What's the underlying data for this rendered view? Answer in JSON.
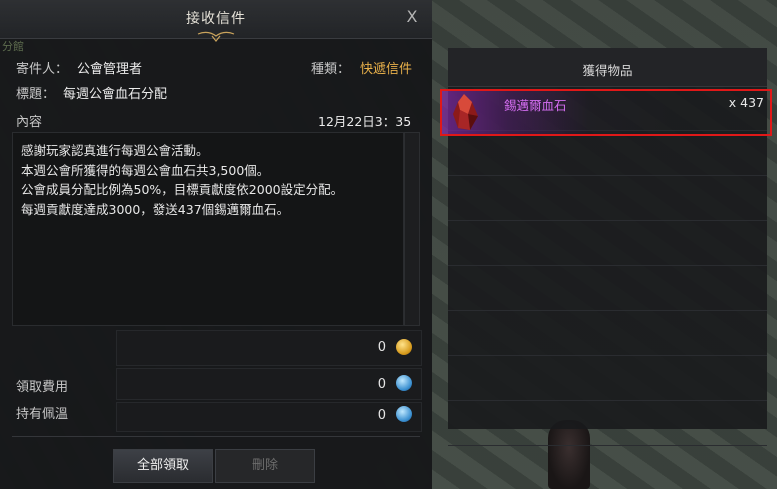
{
  "window": {
    "title": "接收信件",
    "close_label": "X",
    "guild_tag": "分館"
  },
  "header": {
    "sender_label": "寄件人：",
    "sender_value": "公會管理者",
    "type_label": "種類：",
    "type_value": "快遞信件",
    "subject_label": "標題：",
    "subject_value": "每週公會血石分配",
    "content_label": "內容",
    "date": "12月22日3：35"
  },
  "body": {
    "lines": [
      "感謝玩家認真進行每週公會活動。",
      "本週公會所獲得的每週公會血石共3,500個。",
      "公會成員分配比例為50%，目標貢獻度依2000設定分配。",
      "每週貢獻度達成3000，發送437個錫邁爾血石。"
    ]
  },
  "costs": {
    "gold_amount": "0",
    "fee_label": "領取費用",
    "fee_amount": "0",
    "held_label": "持有佩溫",
    "held_amount": "0"
  },
  "buttons": {
    "claim_all": "全部領取",
    "delete": "刪除"
  },
  "attachments": {
    "title": "獲得物品",
    "items": [
      {
        "name": "錫邁爾血石",
        "quantity": "x 437",
        "icon": "bloodstone-icon"
      }
    ]
  },
  "colors": {
    "accent_gold": "#e8b04a",
    "item_purple": "#d36df0",
    "highlight_red": "#e01818"
  }
}
